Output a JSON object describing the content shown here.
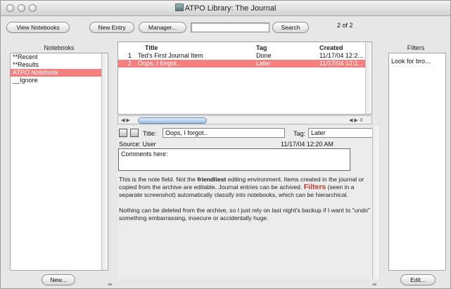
{
  "window": {
    "title": "ATPO Library:  The Journal"
  },
  "toolbar": {
    "view_notebooks": "View Notebooks",
    "new_entry": "New Entry",
    "manager": "Manager...",
    "search_value": "",
    "search_button": "Search",
    "counter": "2 of 2"
  },
  "notebooks": {
    "header": "Notebooks",
    "items": [
      "**Recent",
      "**Results",
      "ATPO Notebook",
      "__Ignore"
    ],
    "new_button": "New..."
  },
  "entries": {
    "columns": {
      "title": "Title",
      "tag": "Tag",
      "created": "Created"
    },
    "rows": [
      {
        "num": "1",
        "title": "Ted's First Journal Item",
        "tag": "Done",
        "created": "11/17/04 12:2..."
      },
      {
        "num": "2",
        "title": "Oops, I forgot...",
        "tag": "Later",
        "created": "11/17/04 12:2..."
      }
    ]
  },
  "editor": {
    "title_label": "Title:",
    "title_value": "Oops, I forgot..",
    "tag_label": "Tag:",
    "tag_value": "Later",
    "source": "Source: User",
    "timestamp": "11/17/04 12:20 AM",
    "comments": "Comments here:",
    "note": {
      "p1_a": "This is the note field. Not the ",
      "p1_bold": "friendliest",
      "p1_b": " editing environment. Items created in the journal or copied from the archive are editable. Journal entries can be achived. ",
      "p1_hl": "Filters",
      "p1_c": " (seen in a separate screenshot) automatically classify into notebooks, which can be hierarchical.",
      "p2": "Nothing can be deleted from the archive, so I just rely on last night's backup if I want to \"undo\" something embarrassing, insecure or accidentally huge."
    }
  },
  "filters": {
    "header": "Filters",
    "items": [
      "Look for bro..."
    ],
    "edit_button": "Edit..."
  },
  "colors": {
    "selection": "#f57f7f",
    "highlight": "#c0392b"
  }
}
